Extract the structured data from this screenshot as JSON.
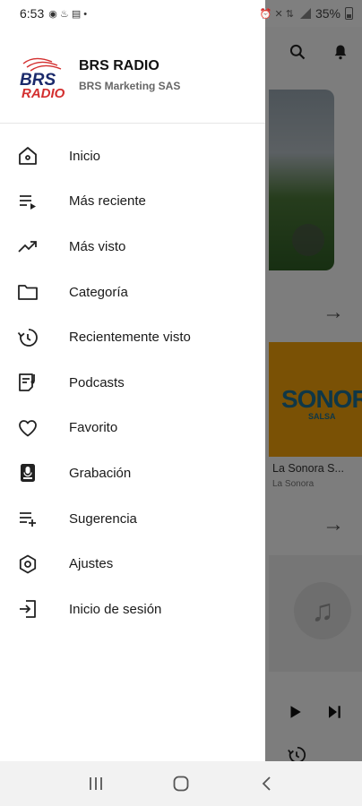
{
  "status_bar": {
    "time": "6:53",
    "battery": "35%"
  },
  "drawer": {
    "brand": {
      "title": "BRS RADIO",
      "subtitle": "BRS Marketing SAS",
      "logo_text": "BRS",
      "logo_subtext": "RADIO"
    },
    "menu": [
      {
        "label": "Inicio",
        "icon": "home-icon"
      },
      {
        "label": "Más reciente",
        "icon": "playlist-play-icon"
      },
      {
        "label": "Más visto",
        "icon": "trending-up-icon"
      },
      {
        "label": "Categoría",
        "icon": "folder-icon"
      },
      {
        "label": "Recientemente visto",
        "icon": "history-icon"
      },
      {
        "label": "Podcasts",
        "icon": "podcast-icon"
      },
      {
        "label": "Favorito",
        "icon": "heart-icon"
      },
      {
        "label": "Grabación",
        "icon": "recorder-icon"
      },
      {
        "label": "Sugerencia",
        "icon": "playlist-add-icon"
      },
      {
        "label": "Ajustes",
        "icon": "settings-icon"
      },
      {
        "label": "Inicio de sesión",
        "icon": "login-icon"
      }
    ]
  },
  "background": {
    "card2_logo": "SONORA",
    "card2_tag": "SALSA",
    "card2_title": "La Sonora S...",
    "card2_subtitle": "La Sonora"
  },
  "colors": {
    "accent": "#d32f2f",
    "scrim": "#000000",
    "drawer_bg": "#ffffff"
  }
}
